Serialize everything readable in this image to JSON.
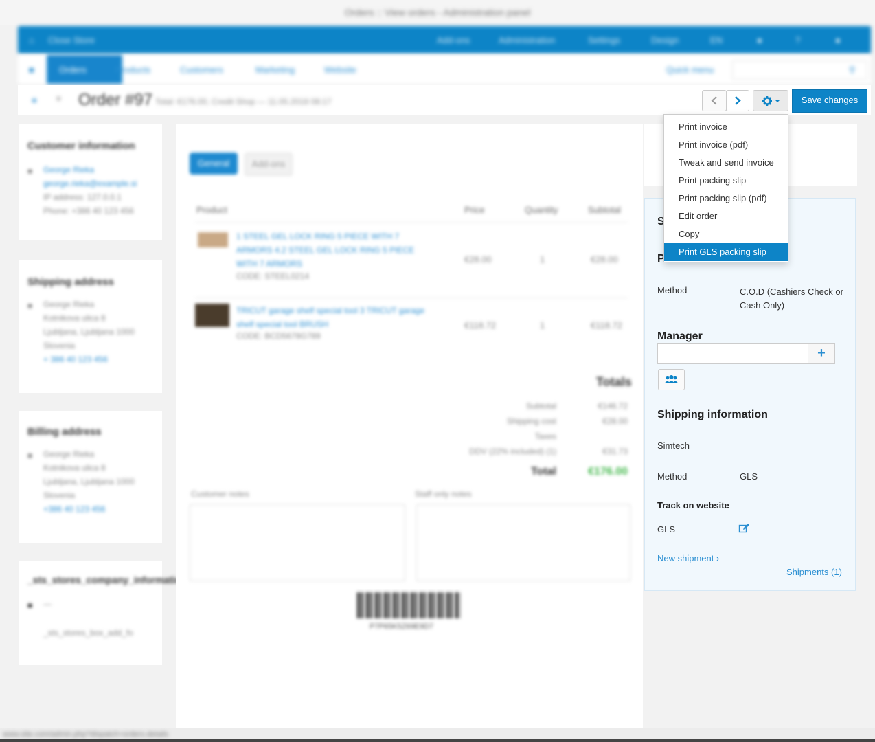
{
  "window": {
    "title": "Orders :: View orders - Administration panel"
  },
  "topbar": {
    "store": "Close Store",
    "items": [
      "Add-ons",
      "Administration",
      "Settings",
      "Design",
      "EN"
    ]
  },
  "menubar": {
    "items": [
      "Orders",
      "Products",
      "Customers",
      "Marketing",
      "Website"
    ],
    "quick_menu": "Quick menu"
  },
  "header": {
    "title": "Order #97",
    "subtitle": "Total: €176.00, Credit Shop — 11.05.2018 08:17"
  },
  "toolbar": {
    "save_label": "Save changes"
  },
  "dropdown": {
    "items": [
      "Print invoice",
      "Print invoice (pdf)",
      "Tweak and send invoice",
      "Print packing slip",
      "Print packing slip (pdf)",
      "Edit order",
      "Copy",
      "Print GLS packing slip"
    ],
    "highlighted_index": 7
  },
  "left": {
    "customer": {
      "heading": "Customer information",
      "lines": [
        "George Rieka",
        "george.rieka@example.si",
        "IP address: 127.0.0.1",
        "Phone: +386 40 123 456"
      ]
    },
    "shipping": {
      "heading": "Shipping address",
      "lines": [
        "George Rieka",
        "Kotnikova ulica 8",
        "Ljubljana, Ljubljana 1000",
        "Slovenia",
        "+ 386 40 123 456"
      ]
    },
    "billing": {
      "heading": "Billing address",
      "lines": [
        "George Rieka",
        "Kotnikova ulica 8",
        "Ljubljana, Ljubljana 1000",
        "Slovenia",
        "+386 40 123 456"
      ]
    },
    "company": {
      "heading": "_sts_stores_company_information",
      "lines": [
        "—",
        "_sts_stores_box_add_fo"
      ]
    }
  },
  "center": {
    "tabs": [
      "General",
      "Add-ons"
    ],
    "columns": [
      "Product",
      "Price",
      "Quantity",
      "Subtotal"
    ],
    "products": [
      {
        "name": "1 STEEL GEL LOCK RING 5 PIECE WITH 7 ARMORS 4.2 STEEL GEL LOCK RING 5 PIECE WITH 7 ARMORS",
        "code": "CODE: STEEL0214",
        "price": "€28.00",
        "qty": "1",
        "subtotal": "€28.00"
      },
      {
        "name": "TRICUT garage shelf special tool 3 TRICUT garage shelf special tool BRUSH",
        "code": "CODE: BCD5678G789",
        "price": "€118.72",
        "qty": "1",
        "subtotal": "€118.72"
      }
    ],
    "totals_heading": "Totals",
    "totals": [
      {
        "label": "Subtotal",
        "value": "€146.72"
      },
      {
        "label": "Shipping cost",
        "value": "€28.00"
      },
      {
        "label": "Taxes",
        "value": ""
      },
      {
        "label": "DDV (22% included) (1)",
        "value": "€31.73"
      }
    ],
    "total_label": "Total",
    "total_value": "€176.00",
    "customer_notes": "Customer notes",
    "staff_notes": "Staff only notes",
    "barcode_text": "P7P65K5Z69E9D7"
  },
  "right": {
    "method_label": "Method",
    "method_value": "C.O.D (Cashiers Check or Cash Only)",
    "manager_heading": "Manager",
    "shipping_heading": "Shipping information",
    "carrier": "Simtech",
    "ship_method_label": "Method",
    "ship_method_value": "GLS",
    "track_heading": "Track on website",
    "track_carrier": "GLS",
    "new_shipment": "New shipment",
    "shipments_link": "Shipments (1)"
  },
  "statusbar": {
    "text": "www.site.com/admin.php?dispatch=orders.details"
  },
  "colors": {
    "accent": "#0d84c7",
    "link": "#2b8fd2",
    "total_green": "#3fb648"
  }
}
